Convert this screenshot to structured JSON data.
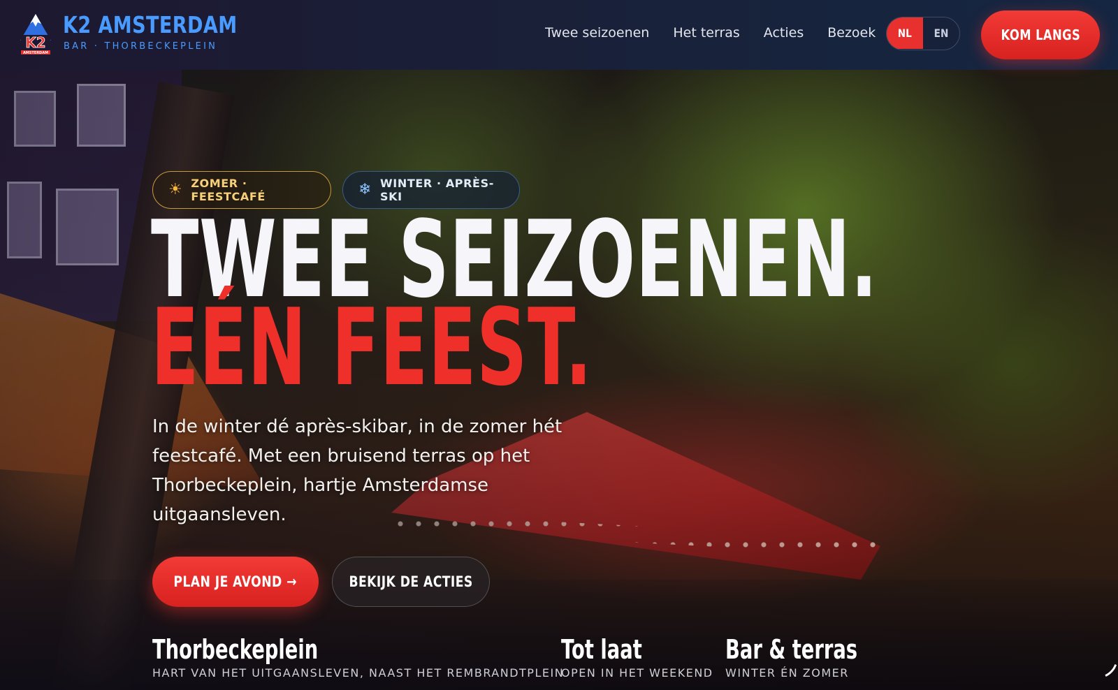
{
  "brand": {
    "name": "K2 AMSTERDAM",
    "tagline": "BAR · THORBECKEPLEIN",
    "logo_text": "K2",
    "logo_sub": "AMSTERDAM"
  },
  "nav": {
    "links": [
      "Twee seizoenen",
      "Het terras",
      "Acties",
      "Bezoek"
    ]
  },
  "language": {
    "options": [
      "NL",
      "EN"
    ],
    "active": "NL"
  },
  "header_cta": "KOM LANGS",
  "season_pills": [
    {
      "icon": "sun-icon",
      "label": "ZOMER · FEESTCAFÉ"
    },
    {
      "icon": "snowflake-icon",
      "label": "WINTER · APRÈS-SKI"
    }
  ],
  "headline": {
    "line1": "TWEE SEIZOENEN.",
    "line2": "EÉN FEEST."
  },
  "intro": "In de winter dé après-skibar, in de zomer hét feestcafé. Met een bruisend terras op het Thorbeckeplein, hartje Amsterdamse uitgaansleven.",
  "buttons": {
    "primary": "PLAN JE AVOND →",
    "secondary": "BEKIJK DE ACTIES"
  },
  "facts": [
    {
      "title": "Thorbeckeplein",
      "subtitle": "HART VAN HET UITGAANSLEVEN, NAAST HET REMBRANDTPLEIN"
    },
    {
      "title": "Tot laat",
      "subtitle": "OPEN IN HET WEEKEND"
    },
    {
      "title": "Bar & terras",
      "subtitle": "WINTER ÉN ZOMER"
    }
  ],
  "colors": {
    "accent_red": "#e8302e",
    "brand_blue": "#4a9bff",
    "header_bg": "#1b1f36",
    "summer_gold": "#f7d07a"
  }
}
